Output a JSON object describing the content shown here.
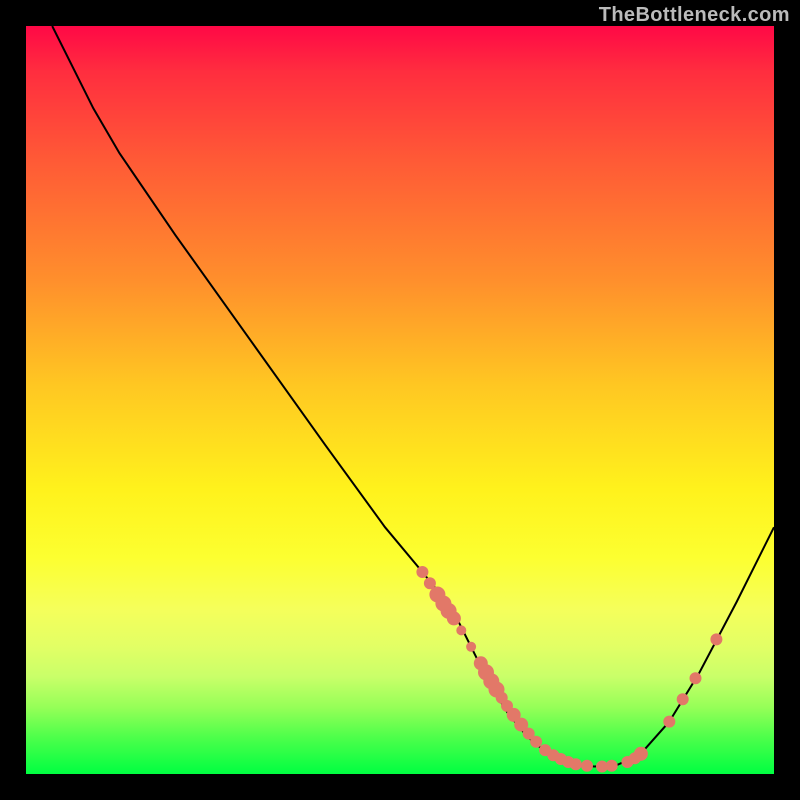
{
  "watermark": "TheBottleneck.com",
  "chart_data": {
    "type": "line",
    "title": "",
    "xlabel": "",
    "ylabel": "",
    "xlim": [
      0,
      100
    ],
    "ylim": [
      0,
      100
    ],
    "grid": false,
    "legend": false,
    "series": [
      {
        "name": "curve",
        "points": [
          {
            "x": 3.5,
            "y": 100.0
          },
          {
            "x": 6.0,
            "y": 95.0
          },
          {
            "x": 9.0,
            "y": 89.0
          },
          {
            "x": 12.5,
            "y": 83.0
          },
          {
            "x": 20.0,
            "y": 72.0
          },
          {
            "x": 30.0,
            "y": 58.0
          },
          {
            "x": 40.0,
            "y": 44.0
          },
          {
            "x": 48.0,
            "y": 33.0
          },
          {
            "x": 53.0,
            "y": 27.0
          },
          {
            "x": 57.0,
            "y": 22.0
          },
          {
            "x": 60.0,
            "y": 16.0
          },
          {
            "x": 62.0,
            "y": 12.0
          },
          {
            "x": 64.5,
            "y": 8.0
          },
          {
            "x": 67.0,
            "y": 5.0
          },
          {
            "x": 70.0,
            "y": 2.5
          },
          {
            "x": 73.0,
            "y": 1.2
          },
          {
            "x": 76.0,
            "y": 1.0
          },
          {
            "x": 79.0,
            "y": 1.2
          },
          {
            "x": 82.0,
            "y": 2.5
          },
          {
            "x": 86.0,
            "y": 7.0
          },
          {
            "x": 90.0,
            "y": 13.5
          },
          {
            "x": 95.0,
            "y": 23.0
          },
          {
            "x": 100.0,
            "y": 33.0
          }
        ]
      }
    ],
    "scatter_points": [
      {
        "x": 53.0,
        "y": 27.0,
        "r": 6
      },
      {
        "x": 54.0,
        "y": 25.5,
        "r": 6
      },
      {
        "x": 55.0,
        "y": 24.0,
        "r": 8
      },
      {
        "x": 55.8,
        "y": 22.8,
        "r": 8
      },
      {
        "x": 56.5,
        "y": 21.8,
        "r": 8
      },
      {
        "x": 57.2,
        "y": 20.8,
        "r": 7
      },
      {
        "x": 58.2,
        "y": 19.2,
        "r": 5
      },
      {
        "x": 59.5,
        "y": 17.0,
        "r": 5
      },
      {
        "x": 60.8,
        "y": 14.8,
        "r": 7
      },
      {
        "x": 61.5,
        "y": 13.6,
        "r": 8
      },
      {
        "x": 62.2,
        "y": 12.4,
        "r": 8
      },
      {
        "x": 62.9,
        "y": 11.3,
        "r": 8
      },
      {
        "x": 63.6,
        "y": 10.2,
        "r": 6
      },
      {
        "x": 64.3,
        "y": 9.1,
        "r": 6
      },
      {
        "x": 65.2,
        "y": 7.9,
        "r": 7
      },
      {
        "x": 66.2,
        "y": 6.6,
        "r": 7
      },
      {
        "x": 67.2,
        "y": 5.4,
        "r": 6
      },
      {
        "x": 68.2,
        "y": 4.3,
        "r": 6
      },
      {
        "x": 69.4,
        "y": 3.2,
        "r": 6
      },
      {
        "x": 70.5,
        "y": 2.5,
        "r": 6
      },
      {
        "x": 71.5,
        "y": 2.0,
        "r": 6
      },
      {
        "x": 72.5,
        "y": 1.6,
        "r": 6
      },
      {
        "x": 73.5,
        "y": 1.3,
        "r": 6
      },
      {
        "x": 75.0,
        "y": 1.1,
        "r": 6
      },
      {
        "x": 77.0,
        "y": 1.0,
        "r": 6
      },
      {
        "x": 78.3,
        "y": 1.1,
        "r": 6
      },
      {
        "x": 80.4,
        "y": 1.6,
        "r": 6
      },
      {
        "x": 81.4,
        "y": 2.1,
        "r": 6
      },
      {
        "x": 82.2,
        "y": 2.7,
        "r": 7
      },
      {
        "x": 86.0,
        "y": 7.0,
        "r": 6
      },
      {
        "x": 87.8,
        "y": 10.0,
        "r": 6
      },
      {
        "x": 89.5,
        "y": 12.8,
        "r": 6
      },
      {
        "x": 92.3,
        "y": 18.0,
        "r": 6
      }
    ]
  }
}
